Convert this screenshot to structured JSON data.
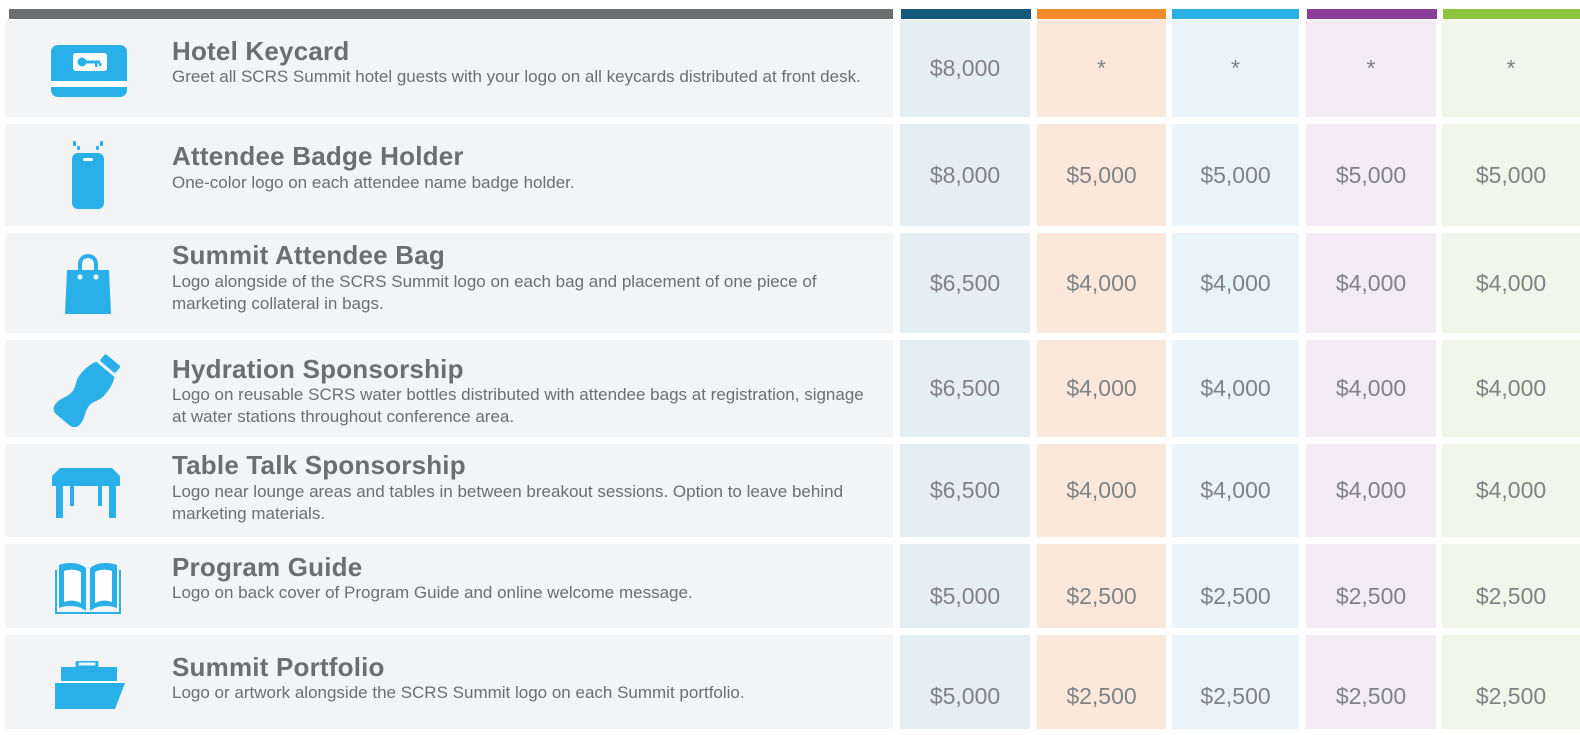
{
  "colors": {
    "header_gray": "#6d6e70",
    "col1_bar": "#14587a",
    "col2_bar": "#f28c28",
    "col3_bar": "#2bb0e6",
    "col4_bar": "#8b3f9a",
    "col5_bar": "#8cc63f",
    "icon_blue": "#29b0e8"
  },
  "rows": [
    {
      "icon": "keycard-icon",
      "title": "Hotel Keycard",
      "description": "Greet all SCRS Summit hotel guests with your logo on all keycards distributed at front desk.",
      "prices": [
        "$8,000",
        "*",
        "*",
        "*",
        "*"
      ]
    },
    {
      "icon": "badge-holder-icon",
      "title": "Attendee Badge Holder",
      "description": "One-color logo on each attendee name badge holder.",
      "prices": [
        "$8,000",
        "$5,000",
        "$5,000",
        "$5,000",
        "$5,000"
      ]
    },
    {
      "icon": "shopping-bag-icon",
      "title": "Summit Attendee Bag",
      "description": "Logo alongside of the SCRS Summit logo on each bag and placement of one piece of marketing collateral in bags.",
      "prices": [
        "$6,500",
        "$4,000",
        "$4,000",
        "$4,000",
        "$4,000"
      ]
    },
    {
      "icon": "water-bottle-icon",
      "title": "Hydration Sponsorship",
      "description": "Logo on reusable SCRS water bottles distributed with attendee bags at registration, signage at water stations throughout conference area.",
      "prices": [
        "$6,500",
        "$4,000",
        "$4,000",
        "$4,000",
        "$4,000"
      ]
    },
    {
      "icon": "table-icon",
      "title": "Table Talk Sponsorship",
      "description": "Logo near lounge areas and tables in between breakout sessions. Option to leave behind marketing materials.",
      "prices": [
        "$6,500",
        "$4,000",
        "$4,000",
        "$4,000",
        "$4,000"
      ]
    },
    {
      "icon": "open-book-icon",
      "title": "Program Guide",
      "description": "Logo on back cover of Program Guide and online welcome message.",
      "prices": [
        "$5,000",
        "$2,500",
        "$2,500",
        "$2,500",
        "$2,500"
      ]
    },
    {
      "icon": "open-folder-icon",
      "title": "Summit Portfolio",
      "description": "Logo or artwork alongside the SCRS Summit logo on each Summit portfolio.",
      "prices": [
        "$5,000",
        "$2,500",
        "$2,500",
        "$2,500",
        "$2,500"
      ]
    }
  ]
}
